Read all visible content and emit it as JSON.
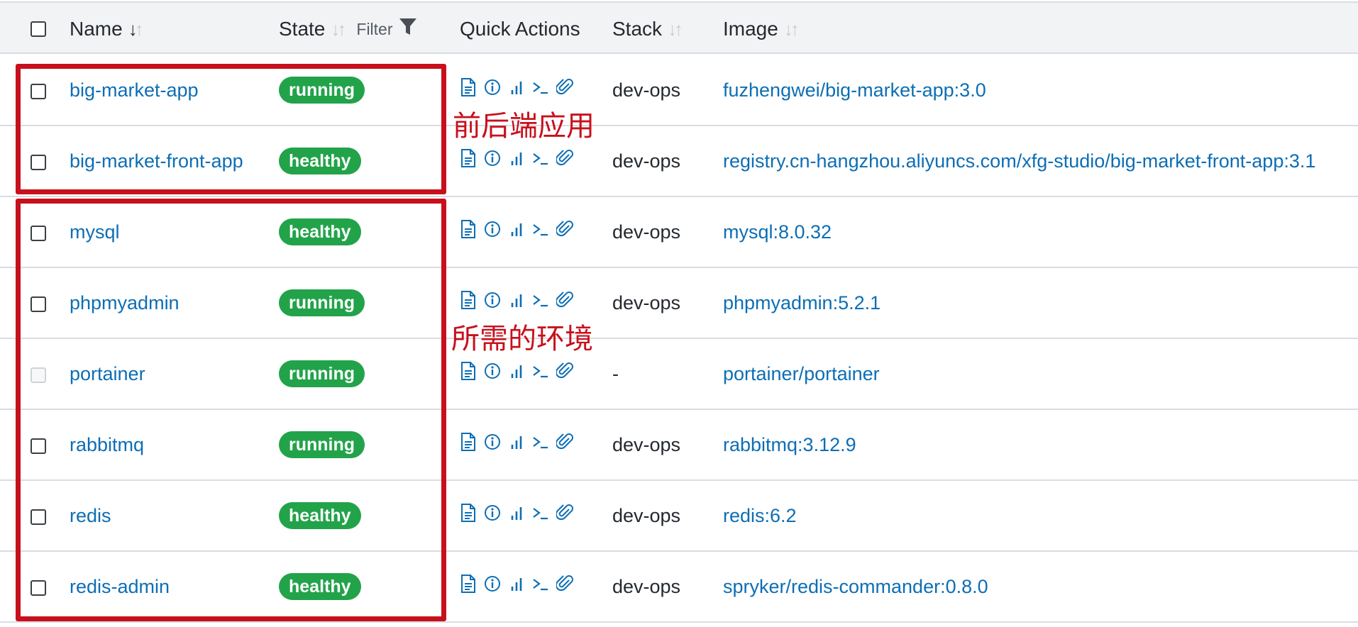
{
  "header": {
    "select_all_checked": false,
    "name_label": "Name",
    "state_label": "State",
    "filter_label": "Filter",
    "quick_actions_label": "Quick Actions",
    "stack_label": "Stack",
    "image_label": "Image"
  },
  "rows": [
    {
      "name": "big-market-app",
      "state": "running",
      "stack": "dev-ops",
      "image": "fuzhengwei/big-market-app:3.0",
      "checkbox_disabled": false
    },
    {
      "name": "big-market-front-app",
      "state": "healthy",
      "stack": "dev-ops",
      "image": "registry.cn-hangzhou.aliyuncs.com/xfg-studio/big-market-front-app:3.1",
      "checkbox_disabled": false
    },
    {
      "name": "mysql",
      "state": "healthy",
      "stack": "dev-ops",
      "image": "mysql:8.0.32",
      "checkbox_disabled": false
    },
    {
      "name": "phpmyadmin",
      "state": "running",
      "stack": "dev-ops",
      "image": "phpmyadmin:5.2.1",
      "checkbox_disabled": false
    },
    {
      "name": "portainer",
      "state": "running",
      "stack": "-",
      "image": "portainer/portainer",
      "checkbox_disabled": true
    },
    {
      "name": "rabbitmq",
      "state": "running",
      "stack": "dev-ops",
      "image": "rabbitmq:3.12.9",
      "checkbox_disabled": false
    },
    {
      "name": "redis",
      "state": "healthy",
      "stack": "dev-ops",
      "image": "redis:6.2",
      "checkbox_disabled": false
    },
    {
      "name": "redis-admin",
      "state": "healthy",
      "stack": "dev-ops",
      "image": "spryker/redis-commander:0.8.0",
      "checkbox_disabled": false
    }
  ],
  "quick_action_icons": [
    "logs-icon",
    "inspect-icon",
    "stats-icon",
    "console-icon",
    "attach-icon"
  ],
  "annotations": {
    "app_group_label": "前后端应用",
    "env_group_label": "所需的环境",
    "highlight_color": "#c8101c"
  },
  "colors": {
    "link": "#0d6eb4",
    "badge_green": "#22a34a",
    "header_bg": "#f2f3f5"
  }
}
